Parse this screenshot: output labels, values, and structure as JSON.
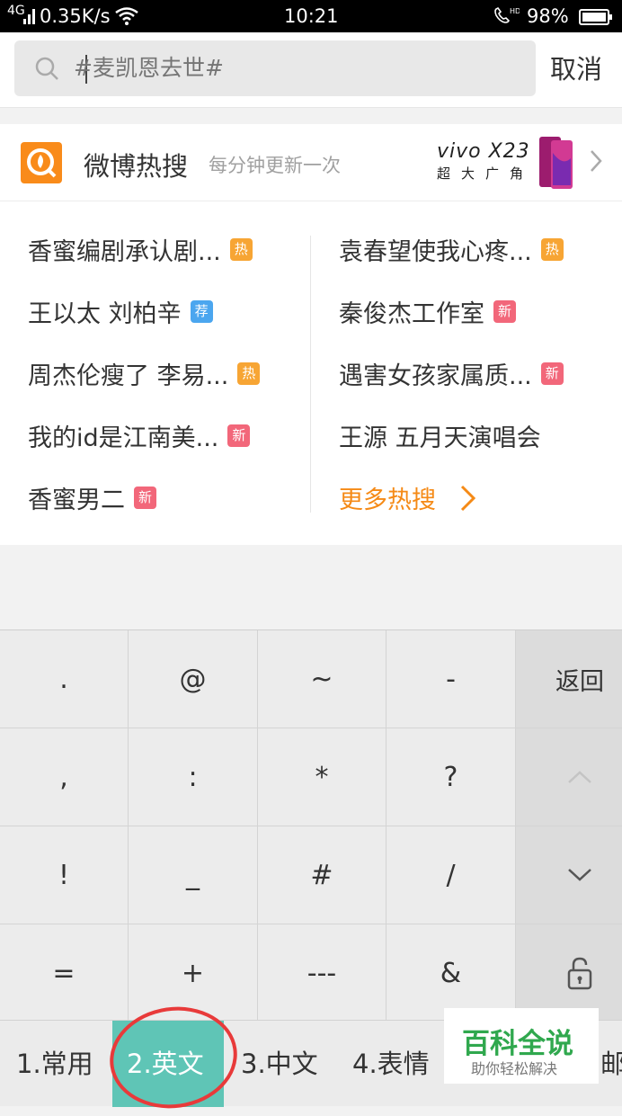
{
  "status_bar": {
    "signal": "4G",
    "speed": "0.35K/s",
    "time": "10:21",
    "battery": "98%"
  },
  "search": {
    "placeholder": "#麦凯恩去世#",
    "cancel_label": "取消"
  },
  "hot_search": {
    "title": "微博热搜",
    "subtitle": "每分钟更新一次",
    "ad_brand": "vivo X23",
    "ad_sub": "超大广角",
    "left_items": [
      {
        "text": "香蜜编剧承认剧...",
        "badge": "热",
        "badge_type": "hot"
      },
      {
        "text": "王以太 刘柏辛",
        "badge": "荐",
        "badge_type": "rec"
      },
      {
        "text": "周杰伦瘦了 李易...",
        "badge": "热",
        "badge_type": "hot"
      },
      {
        "text": "我的id是江南美...",
        "badge": "新",
        "badge_type": "new"
      },
      {
        "text": "香蜜男二",
        "badge": "新",
        "badge_type": "new"
      }
    ],
    "right_items": [
      {
        "text": "袁春望使我心疼...",
        "badge": "热",
        "badge_type": "hot"
      },
      {
        "text": "秦俊杰工作室",
        "badge": "新",
        "badge_type": "new"
      },
      {
        "text": "遇害女孩家属质...",
        "badge": "新",
        "badge_type": "new"
      },
      {
        "text": "王源 五月天演唱会",
        "badge": "",
        "badge_type": ""
      }
    ],
    "more_label": "更多热搜"
  },
  "keyboard": {
    "rows": [
      [
        ".",
        "@",
        "~",
        "-",
        "返回"
      ],
      [
        ",",
        ":",
        "*",
        "?",
        ""
      ],
      [
        "!",
        "_",
        "#",
        "/",
        ""
      ],
      [
        "=",
        "+",
        "---",
        "&",
        ""
      ]
    ]
  },
  "tabs": [
    "1.常用",
    "2.英文",
    "3.中文",
    "4.表情",
    "邮"
  ],
  "watermark": {
    "title": "百科全说",
    "subtitle": "助你轻松解决"
  },
  "colors": {
    "accent_orange": "#f58a16",
    "badge_hot": "#f7a534",
    "badge_new": "#f2677a",
    "badge_rec": "#4ba6ef",
    "tab_active": "#5fc5b6",
    "circle": "#e83a3a"
  }
}
